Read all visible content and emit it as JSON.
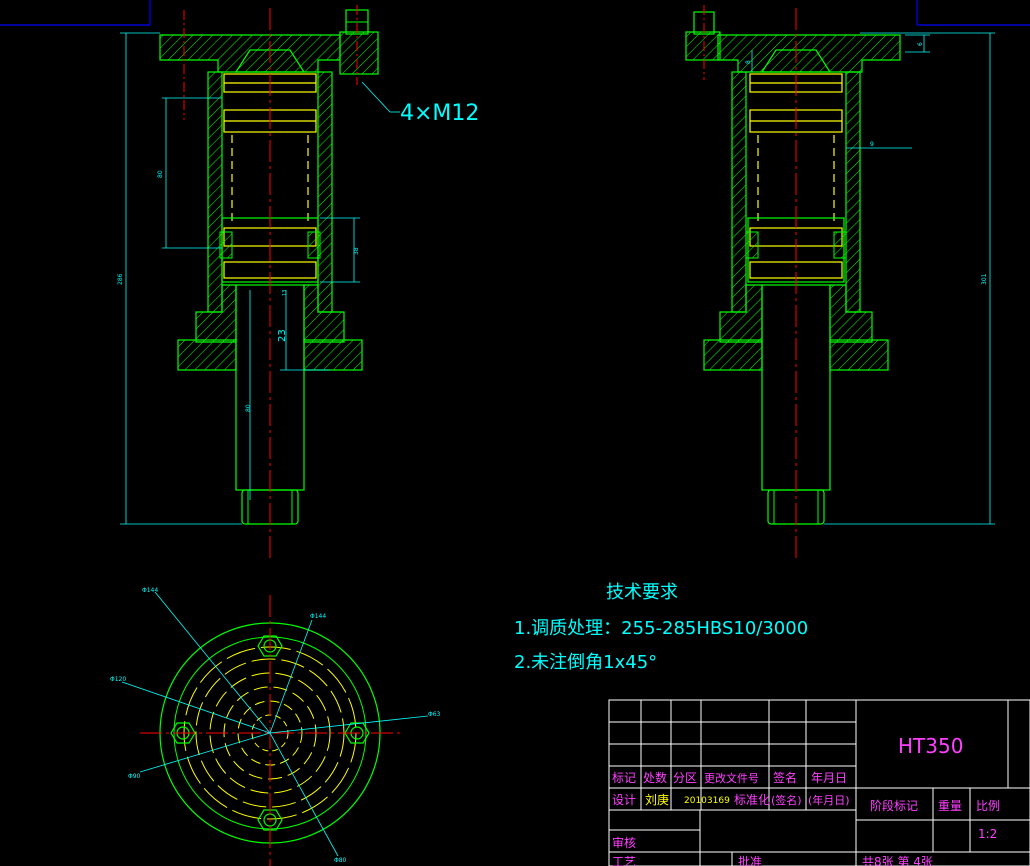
{
  "callout": {
    "bolts": "4×M12"
  },
  "dims_left": {
    "overall": "286",
    "upper": "80",
    "seal": "38",
    "d1": "23",
    "d2": "13",
    "rod": "80"
  },
  "dims_right": {
    "overall": "301",
    "top": "6",
    "inner": "9",
    "flange": "8"
  },
  "plan_labels": {
    "a": "Φ144",
    "b": "Φ144",
    "c": "Φ120",
    "d": "Φ63",
    "e": "Φ90",
    "f": "Φ80"
  },
  "tech": {
    "heading": "技术要求",
    "line1": "1.调质处理：255-285HBS10/3000",
    "line2": "2.未注倒角1x45°"
  },
  "title_block": {
    "material": "HT350",
    "row_labels": [
      "标记",
      "处数",
      "分区",
      "更改文件号",
      "签名",
      "年月日"
    ],
    "design_row": [
      "设计",
      "刘庚",
      "20103169",
      "标准化",
      "(签名)",
      "(年月日)"
    ],
    "stage": "阶段标记",
    "weight": "重量",
    "ratio_label": "比例",
    "ratio": "1:2",
    "review": "审核",
    "process": "工艺",
    "approve": "批准",
    "sheets": "共8张 第 4张"
  },
  "colors": {
    "line": "#00ff00",
    "center": "#ff0000",
    "hidden": "#ffff00",
    "dim": "#00ffff",
    "frame": "#0000ff",
    "title": "#ff40ff",
    "white": "#ffffff"
  }
}
